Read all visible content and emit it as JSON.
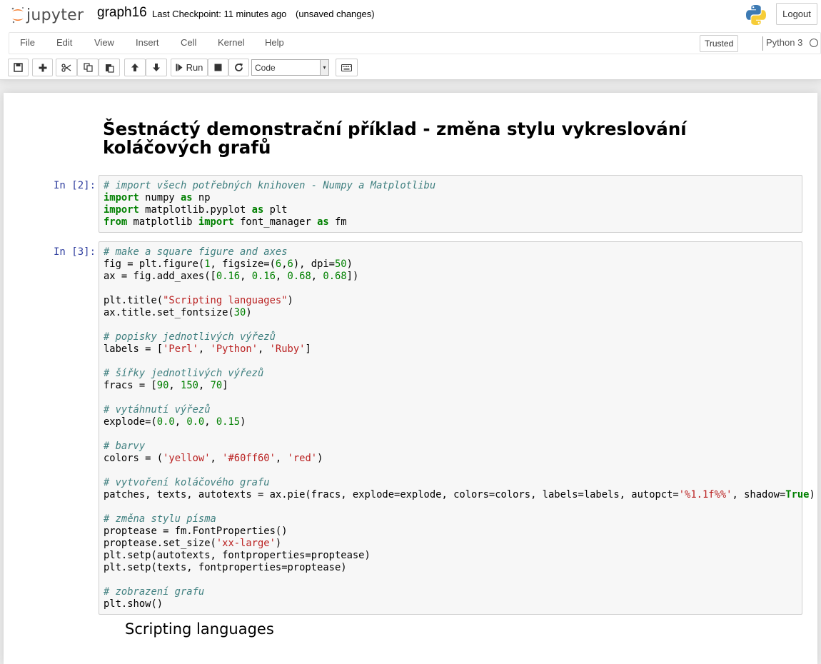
{
  "header": {
    "logo_text": "jupyter",
    "notebook_name": "graph16",
    "checkpoint": "Last Checkpoint: 11 minutes ago",
    "autosave_status": "(unsaved changes)",
    "logout_label": "Logout"
  },
  "menubar": {
    "items": [
      "File",
      "Edit",
      "View",
      "Insert",
      "Cell",
      "Kernel",
      "Help"
    ],
    "trusted_label": "Trusted",
    "kernel_name": "Python 3"
  },
  "toolbar": {
    "run_label": "Run",
    "cell_type": "Code",
    "cell_type_options": [
      "Code"
    ]
  },
  "notebook": {
    "markdown_title": "Šestnáctý demonstrační příklad - změna stylu vykreslování koláčových grafů",
    "cells": [
      {
        "prompt": "In [2]:",
        "lines": [
          [
            [
              "cm",
              "# import všech potřebných knihoven - Numpy a Matplotlibu"
            ]
          ],
          [
            [
              "kw",
              "import"
            ],
            [
              "",
              " numpy "
            ],
            [
              "kw",
              "as"
            ],
            [
              "",
              " np"
            ]
          ],
          [
            [
              "kw",
              "import"
            ],
            [
              "",
              " matplotlib.pyplot "
            ],
            [
              "kw",
              "as"
            ],
            [
              "",
              " plt"
            ]
          ],
          [
            [
              "kw",
              "from"
            ],
            [
              "",
              " matplotlib "
            ],
            [
              "kw",
              "import"
            ],
            [
              "",
              " font_manager "
            ],
            [
              "kw",
              "as"
            ],
            [
              "",
              " fm"
            ]
          ]
        ]
      },
      {
        "prompt": "In [3]:",
        "lines": [
          [
            [
              "cm",
              "# make a square figure and axes"
            ]
          ],
          [
            [
              "",
              "fig = plt.figure("
            ],
            [
              "nm",
              "1"
            ],
            [
              "",
              ", figsize=("
            ],
            [
              "nm",
              "6"
            ],
            [
              "",
              ","
            ],
            [
              "nm",
              "6"
            ],
            [
              "",
              "), dpi="
            ],
            [
              "nm",
              "50"
            ],
            [
              "",
              ")"
            ]
          ],
          [
            [
              "",
              "ax = fig.add_axes(["
            ],
            [
              "nm",
              "0.16"
            ],
            [
              "",
              ", "
            ],
            [
              "nm",
              "0.16"
            ],
            [
              "",
              ", "
            ],
            [
              "nm",
              "0.68"
            ],
            [
              "",
              ", "
            ],
            [
              "nm",
              "0.68"
            ],
            [
              "",
              "])"
            ]
          ],
          [],
          [
            [
              "",
              "plt.title("
            ],
            [
              "st",
              "\"Scripting languages\""
            ],
            [
              "",
              ")"
            ]
          ],
          [
            [
              "",
              "ax.title.set_fontsize("
            ],
            [
              "nm",
              "30"
            ],
            [
              "",
              ")"
            ]
          ],
          [],
          [
            [
              "cm",
              "# popisky jednotlivých výřezů"
            ]
          ],
          [
            [
              "",
              "labels = ["
            ],
            [
              "st",
              "'Perl'"
            ],
            [
              "",
              ", "
            ],
            [
              "st",
              "'Python'"
            ],
            [
              "",
              ", "
            ],
            [
              "st",
              "'Ruby'"
            ],
            [
              "",
              "]"
            ]
          ],
          [],
          [
            [
              "cm",
              "# šířky jednotlivých výřezů"
            ]
          ],
          [
            [
              "",
              "fracs = ["
            ],
            [
              "nm",
              "90"
            ],
            [
              "",
              ", "
            ],
            [
              "nm",
              "150"
            ],
            [
              "",
              ", "
            ],
            [
              "nm",
              "70"
            ],
            [
              "",
              "]"
            ]
          ],
          [],
          [
            [
              "cm",
              "# vytáhnutí výřezů"
            ]
          ],
          [
            [
              "",
              "explode=("
            ],
            [
              "nm",
              "0.0"
            ],
            [
              "",
              ", "
            ],
            [
              "nm",
              "0.0"
            ],
            [
              "",
              ", "
            ],
            [
              "nm",
              "0.15"
            ],
            [
              "",
              ")"
            ]
          ],
          [],
          [
            [
              "cm",
              "# barvy"
            ]
          ],
          [
            [
              "",
              "colors = ("
            ],
            [
              "st",
              "'yellow'"
            ],
            [
              "",
              ", "
            ],
            [
              "st",
              "'#60ff60'"
            ],
            [
              "",
              ", "
            ],
            [
              "st",
              "'red'"
            ],
            [
              "",
              ")"
            ]
          ],
          [],
          [
            [
              "cm",
              "# vytvoření koláčového grafu"
            ]
          ],
          [
            [
              "",
              "patches, texts, autotexts = ax.pie(fracs, explode=explode, colors=colors, labels=labels, autopct="
            ],
            [
              "st",
              "'%1.1f%%'"
            ],
            [
              "",
              ", shadow="
            ],
            [
              "kw",
              "True"
            ],
            [
              "",
              ")"
            ]
          ],
          [],
          [
            [
              "cm",
              "# změna stylu písma"
            ]
          ],
          [
            [
              "",
              "proptease = fm.FontProperties()"
            ]
          ],
          [
            [
              "",
              "proptease.set_size("
            ],
            [
              "st",
              "'xx-large'"
            ],
            [
              "",
              ")"
            ]
          ],
          [
            [
              "",
              "plt.setp(autotexts, fontproperties=proptease)"
            ]
          ],
          [
            [
              "",
              "plt.setp(texts, fontproperties=proptease)"
            ]
          ],
          [],
          [
            [
              "cm",
              "# zobrazení grafu"
            ]
          ],
          [
            [
              "",
              "plt.show()"
            ]
          ]
        ]
      }
    ],
    "output_title": "Scripting languages"
  }
}
